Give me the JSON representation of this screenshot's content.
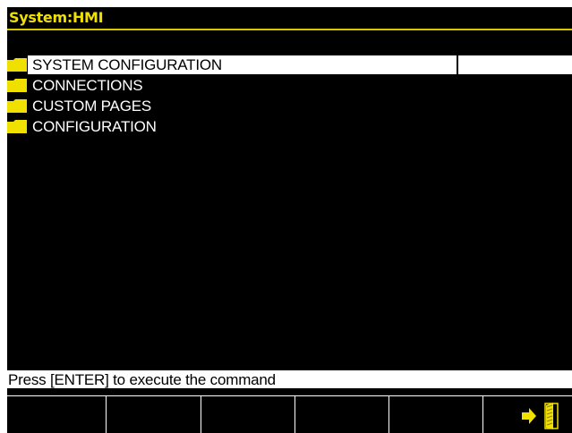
{
  "title": "System:HMI",
  "menu": {
    "items": [
      {
        "label": "SYSTEM CONFIGURATION",
        "icon": "folder-icon",
        "selected": true
      },
      {
        "label": "CONNECTIONS",
        "icon": "folder-icon",
        "selected": false
      },
      {
        "label": "CUSTOM PAGES",
        "icon": "folder-icon",
        "selected": false
      },
      {
        "label": "CONFIGURATION",
        "icon": "folder-icon",
        "selected": false
      }
    ]
  },
  "status": {
    "text": "Press [ENTER] to execute the command"
  },
  "softkeys": {
    "count": 6,
    "last_icon": "exit-door-icon"
  },
  "colors": {
    "background": "#000000",
    "title_text": "#f0e000",
    "title_rule": "#d8c800",
    "folder": "#f0e000",
    "selection": "#ffffff",
    "text": "#ffffff"
  }
}
